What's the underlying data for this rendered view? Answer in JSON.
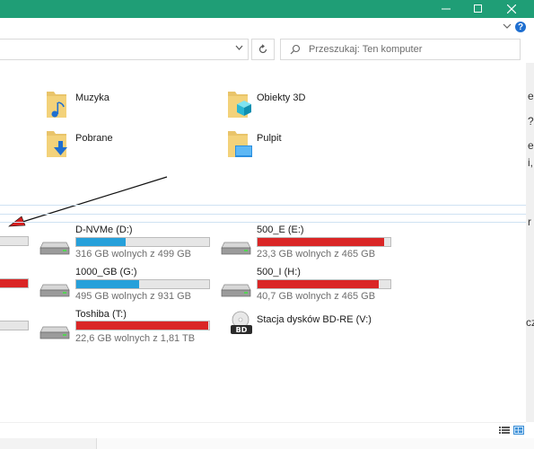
{
  "window": {
    "minimize_label": "minimize",
    "maximize_label": "maximize",
    "close_label": "close",
    "help_label": "?"
  },
  "search": {
    "placeholder": "Przeszukaj: Ten komputer"
  },
  "folders": [
    {
      "label": "Muzyka",
      "icon": "music-folder-icon"
    },
    {
      "label": "Obiekty 3D",
      "icon": "objects3d-folder-icon"
    },
    {
      "label": "Pobrane",
      "icon": "downloads-folder-icon"
    },
    {
      "label": "Pulpit",
      "icon": "desktop-folder-icon"
    }
  ],
  "drives": [
    {
      "name": "D-NVMe (D:)",
      "free": "316 GB wolnych z 499 GB",
      "used_fraction": 0.37,
      "color": "#26a0da"
    },
    {
      "name": "500_E (E:)",
      "free": "23,3 GB wolnych z 465 GB",
      "used_fraction": 0.95,
      "color": "#da2626"
    },
    {
      "name": "1000_GB (G:)",
      "free": "495 GB wolnych z 931 GB",
      "used_fraction": 0.47,
      "color": "#26a0da"
    },
    {
      "name": "500_I (H:)",
      "free": "40,7 GB wolnych z 465 GB",
      "used_fraction": 0.91,
      "color": "#da2626"
    },
    {
      "name": "Toshiba (T:)",
      "free": "22,6 GB wolnych z 1,81 TB",
      "used_fraction": 0.99,
      "color": "#da2626"
    },
    {
      "name": "Stacja dysków BD-RE (V:)",
      "icon": "bd-drive-icon"
    }
  ],
  "partial_drives": [
    {
      "used_fraction": 0.0,
      "color": "#26a0da"
    },
    {
      "used_fraction": 1.0,
      "color": "#da2626"
    },
    {
      "used_fraction": 0.0,
      "color": "#26a0da"
    }
  ],
  "behind_text": [
    "e",
    "?",
    "e",
    "i,",
    "r",
    "cz"
  ],
  "colors": {
    "titlebar": "#1f9e76",
    "accent": "#26a0da",
    "warn": "#da2626"
  }
}
